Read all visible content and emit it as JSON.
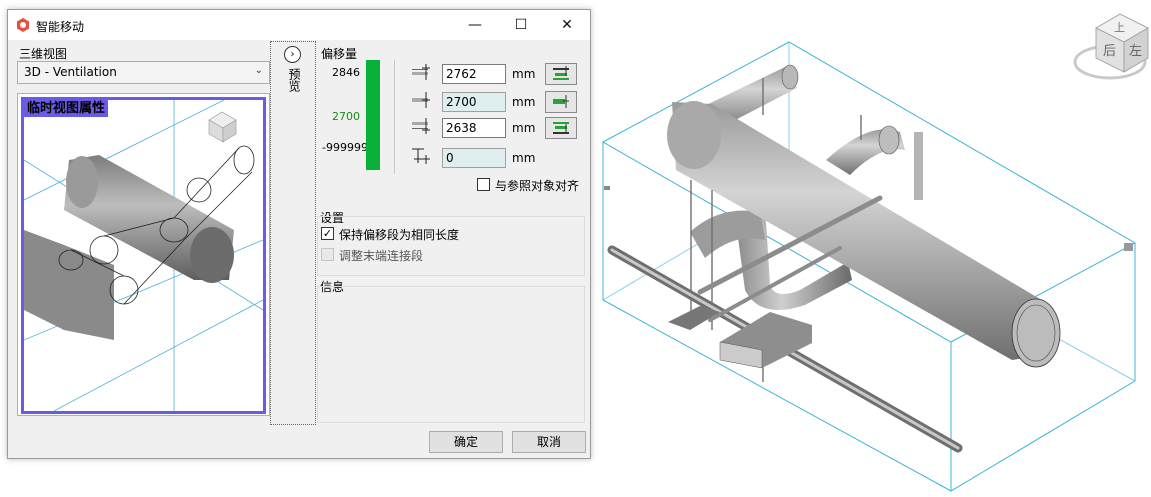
{
  "dialog": {
    "title": "智能移动",
    "controls": {
      "minimize": "—",
      "maximize": "☐",
      "close": "✕"
    }
  },
  "view": {
    "label": "三维视图",
    "selected": "3D - Ventilation",
    "preview_title": "临时视图属性"
  },
  "preview_toggle": {
    "label": "预览",
    "icon": "chevron-right-icon"
  },
  "offset": {
    "label": "偏移量",
    "scale_top": "2846",
    "scale_mid": "2700",
    "scale_bottom": "-999999",
    "rows": [
      {
        "value": "2762",
        "unit": "mm"
      },
      {
        "value": "2700",
        "unit": "mm"
      },
      {
        "value": "2638",
        "unit": "mm"
      },
      {
        "value": "0",
        "unit": "mm"
      }
    ],
    "align_reference_label": "与参照对象对齐"
  },
  "settings": {
    "label": "设置",
    "keep_same_length": {
      "label": "保持偏移段为相同长度",
      "checked": true
    },
    "adjust_end_segments": {
      "label": "调整末端连接段",
      "checked": false
    }
  },
  "info": {
    "label": "信息"
  },
  "buttons": {
    "ok": "确定",
    "cancel": "取消"
  },
  "viewcube": {
    "top_face": "上",
    "left_face": "后",
    "right_face": "左"
  },
  "colors": {
    "accent_purple": "#6a5ae8",
    "bar_green": "#09b13a",
    "box_cyan": "#3ab4d8"
  }
}
